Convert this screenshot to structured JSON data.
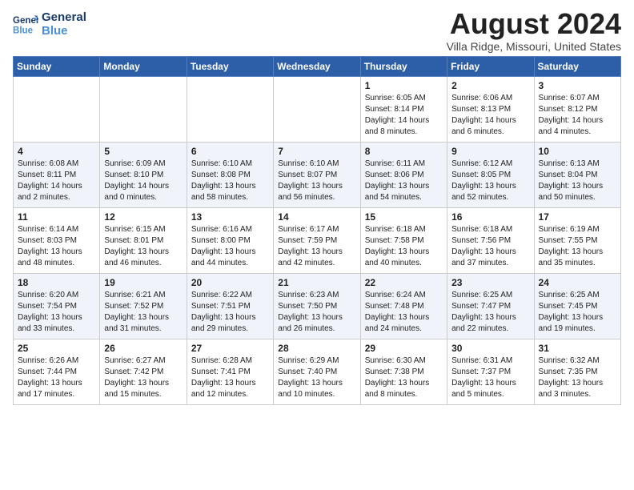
{
  "logo": {
    "line1": "General",
    "line2": "Blue"
  },
  "title": "August 2024",
  "location": "Villa Ridge, Missouri, United States",
  "days_of_week": [
    "Sunday",
    "Monday",
    "Tuesday",
    "Wednesday",
    "Thursday",
    "Friday",
    "Saturday"
  ],
  "weeks": [
    [
      {
        "day": "",
        "text": ""
      },
      {
        "day": "",
        "text": ""
      },
      {
        "day": "",
        "text": ""
      },
      {
        "day": "",
        "text": ""
      },
      {
        "day": "1",
        "text": "Sunrise: 6:05 AM\nSunset: 8:14 PM\nDaylight: 14 hours\nand 8 minutes."
      },
      {
        "day": "2",
        "text": "Sunrise: 6:06 AM\nSunset: 8:13 PM\nDaylight: 14 hours\nand 6 minutes."
      },
      {
        "day": "3",
        "text": "Sunrise: 6:07 AM\nSunset: 8:12 PM\nDaylight: 14 hours\nand 4 minutes."
      }
    ],
    [
      {
        "day": "4",
        "text": "Sunrise: 6:08 AM\nSunset: 8:11 PM\nDaylight: 14 hours\nand 2 minutes."
      },
      {
        "day": "5",
        "text": "Sunrise: 6:09 AM\nSunset: 8:10 PM\nDaylight: 14 hours\nand 0 minutes."
      },
      {
        "day": "6",
        "text": "Sunrise: 6:10 AM\nSunset: 8:08 PM\nDaylight: 13 hours\nand 58 minutes."
      },
      {
        "day": "7",
        "text": "Sunrise: 6:10 AM\nSunset: 8:07 PM\nDaylight: 13 hours\nand 56 minutes."
      },
      {
        "day": "8",
        "text": "Sunrise: 6:11 AM\nSunset: 8:06 PM\nDaylight: 13 hours\nand 54 minutes."
      },
      {
        "day": "9",
        "text": "Sunrise: 6:12 AM\nSunset: 8:05 PM\nDaylight: 13 hours\nand 52 minutes."
      },
      {
        "day": "10",
        "text": "Sunrise: 6:13 AM\nSunset: 8:04 PM\nDaylight: 13 hours\nand 50 minutes."
      }
    ],
    [
      {
        "day": "11",
        "text": "Sunrise: 6:14 AM\nSunset: 8:03 PM\nDaylight: 13 hours\nand 48 minutes."
      },
      {
        "day": "12",
        "text": "Sunrise: 6:15 AM\nSunset: 8:01 PM\nDaylight: 13 hours\nand 46 minutes."
      },
      {
        "day": "13",
        "text": "Sunrise: 6:16 AM\nSunset: 8:00 PM\nDaylight: 13 hours\nand 44 minutes."
      },
      {
        "day": "14",
        "text": "Sunrise: 6:17 AM\nSunset: 7:59 PM\nDaylight: 13 hours\nand 42 minutes."
      },
      {
        "day": "15",
        "text": "Sunrise: 6:18 AM\nSunset: 7:58 PM\nDaylight: 13 hours\nand 40 minutes."
      },
      {
        "day": "16",
        "text": "Sunrise: 6:18 AM\nSunset: 7:56 PM\nDaylight: 13 hours\nand 37 minutes."
      },
      {
        "day": "17",
        "text": "Sunrise: 6:19 AM\nSunset: 7:55 PM\nDaylight: 13 hours\nand 35 minutes."
      }
    ],
    [
      {
        "day": "18",
        "text": "Sunrise: 6:20 AM\nSunset: 7:54 PM\nDaylight: 13 hours\nand 33 minutes."
      },
      {
        "day": "19",
        "text": "Sunrise: 6:21 AM\nSunset: 7:52 PM\nDaylight: 13 hours\nand 31 minutes."
      },
      {
        "day": "20",
        "text": "Sunrise: 6:22 AM\nSunset: 7:51 PM\nDaylight: 13 hours\nand 29 minutes."
      },
      {
        "day": "21",
        "text": "Sunrise: 6:23 AM\nSunset: 7:50 PM\nDaylight: 13 hours\nand 26 minutes."
      },
      {
        "day": "22",
        "text": "Sunrise: 6:24 AM\nSunset: 7:48 PM\nDaylight: 13 hours\nand 24 minutes."
      },
      {
        "day": "23",
        "text": "Sunrise: 6:25 AM\nSunset: 7:47 PM\nDaylight: 13 hours\nand 22 minutes."
      },
      {
        "day": "24",
        "text": "Sunrise: 6:25 AM\nSunset: 7:45 PM\nDaylight: 13 hours\nand 19 minutes."
      }
    ],
    [
      {
        "day": "25",
        "text": "Sunrise: 6:26 AM\nSunset: 7:44 PM\nDaylight: 13 hours\nand 17 minutes."
      },
      {
        "day": "26",
        "text": "Sunrise: 6:27 AM\nSunset: 7:42 PM\nDaylight: 13 hours\nand 15 minutes."
      },
      {
        "day": "27",
        "text": "Sunrise: 6:28 AM\nSunset: 7:41 PM\nDaylight: 13 hours\nand 12 minutes."
      },
      {
        "day": "28",
        "text": "Sunrise: 6:29 AM\nSunset: 7:40 PM\nDaylight: 13 hours\nand 10 minutes."
      },
      {
        "day": "29",
        "text": "Sunrise: 6:30 AM\nSunset: 7:38 PM\nDaylight: 13 hours\nand 8 minutes."
      },
      {
        "day": "30",
        "text": "Sunrise: 6:31 AM\nSunset: 7:37 PM\nDaylight: 13 hours\nand 5 minutes."
      },
      {
        "day": "31",
        "text": "Sunrise: 6:32 AM\nSunset: 7:35 PM\nDaylight: 13 hours\nand 3 minutes."
      }
    ]
  ]
}
